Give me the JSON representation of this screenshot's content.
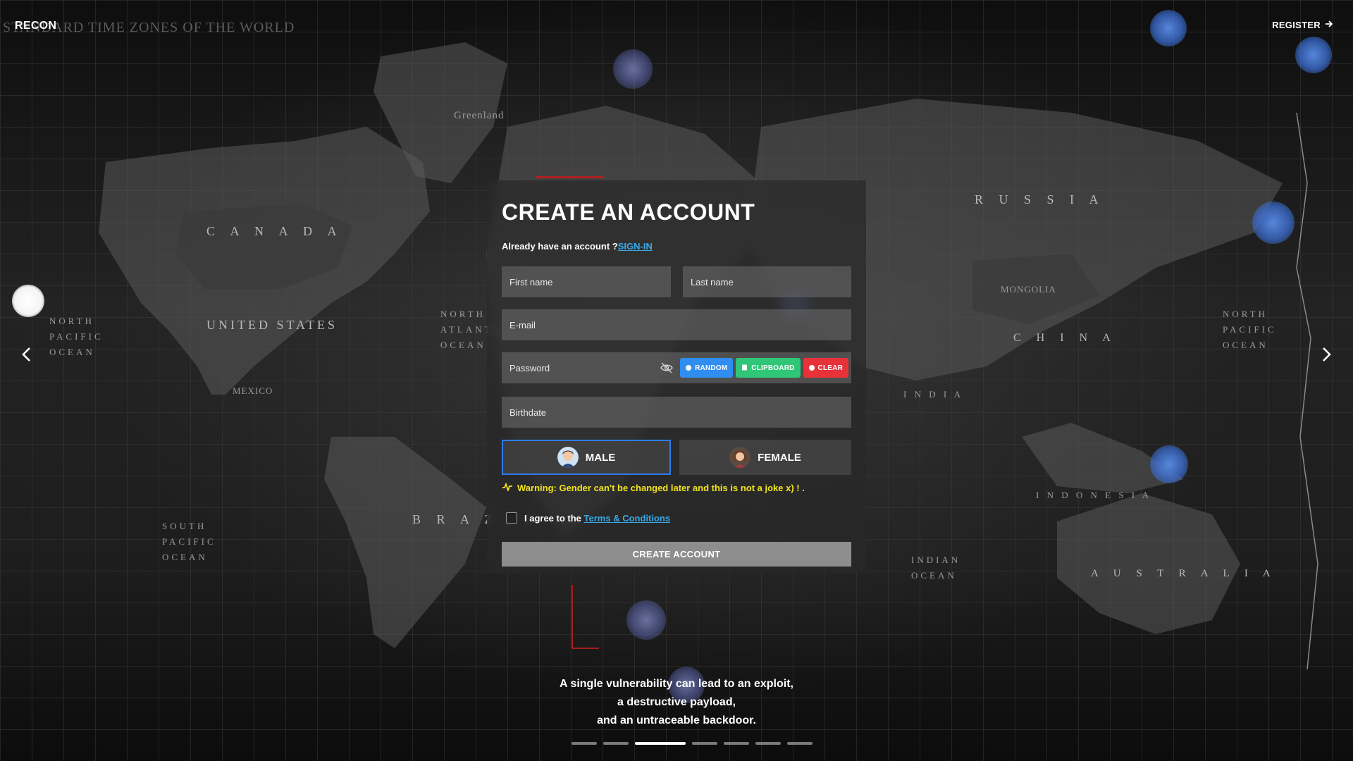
{
  "brand": {
    "logo": "RECON"
  },
  "header": {
    "register_label": "REGISTER"
  },
  "map": {
    "title": "STANDARD TIME ZONES OF THE WORLD",
    "labels": {
      "canada": "C A N A D A",
      "united_states": "UNITED STATES",
      "russia": "R U S S I A",
      "china": "C H I N A",
      "brazil": "B R A Z I L",
      "australia": "A U S T R A L I A",
      "indonesia": "I N D O N E S I A",
      "mongolia": "MONGOLIA",
      "india": "I N D I A",
      "mexico": "MEXICO",
      "greenland": "Greenland",
      "north_pacific": "NORTH PACIFIC OCEAN",
      "south_pacific": "SOUTH PACIFIC OCEAN",
      "north_atlantic": "NORTH ATLANTIC OCEAN",
      "indian_ocean": "INDIAN OCEAN"
    }
  },
  "form": {
    "title": "CREATE AN ACCOUNT",
    "signin_prompt": "Already have an account ?",
    "signin_link": "SIGN-IN",
    "first_name_placeholder": "First name",
    "last_name_placeholder": "Last name",
    "email_placeholder": "E-mail",
    "password_placeholder": "Password",
    "birthdate_placeholder": "Birthdate",
    "password_tools": {
      "random": "RANDOM",
      "clipboard": "CLIPBOARD",
      "clear": "CLEAR"
    },
    "gender": {
      "male": "MALE",
      "female": "FEMALE",
      "selected": "MALE"
    },
    "warning": "Warning: Gender can't be changed later and this is not a joke x) ! .",
    "agree_prefix": "I agree to the",
    "terms_link": "Terms & Conditions",
    "submit": "CREATE ACCOUNT"
  },
  "tagline": {
    "line1": "A single vulnerability can lead to an exploit,",
    "line2": "a destructive payload,",
    "line3": "and an untraceable backdoor."
  },
  "carousel": {
    "total": 7,
    "active_index": 2
  },
  "colors": {
    "accent_blue": "#2f7bf0",
    "link": "#3aa8e6",
    "warning": "#f1e31f",
    "random": "#2f8ef0",
    "clipboard": "#2fc777",
    "clear": "#e8323a"
  }
}
